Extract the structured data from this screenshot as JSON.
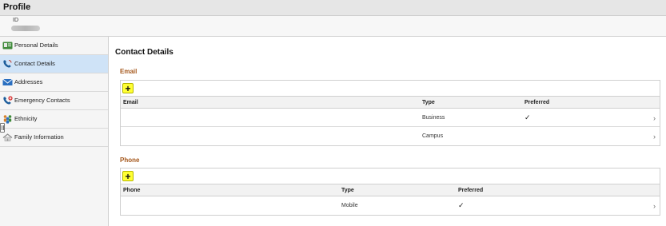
{
  "header": {
    "title": "Profile"
  },
  "id_bar": {
    "label": "ID"
  },
  "sidebar": {
    "items": [
      {
        "label": "Personal Details",
        "icon": "id-card-icon",
        "active": false
      },
      {
        "label": "Contact Details",
        "icon": "phone-icon",
        "active": true
      },
      {
        "label": "Addresses",
        "icon": "envelope-icon",
        "active": false
      },
      {
        "label": "Emergency Contacts",
        "icon": "emergency-phone-icon",
        "active": false
      },
      {
        "label": "Ethnicity",
        "icon": "people-icon",
        "active": false
      },
      {
        "label": "Family Information",
        "icon": "house-icon",
        "active": false
      }
    ]
  },
  "main": {
    "title": "Contact Details",
    "email": {
      "section_title": "Email",
      "add_label": "+",
      "columns": [
        "Email",
        "Type",
        "Preferred"
      ],
      "rows": [
        {
          "email": "",
          "type": "Business",
          "preferred": "✓",
          "chevron": "›"
        },
        {
          "email": "",
          "type": "Campus",
          "preferred": "",
          "chevron": "›"
        }
      ]
    },
    "phone": {
      "section_title": "Phone",
      "add_label": "+",
      "columns": [
        "Phone",
        "Type",
        "Preferred"
      ],
      "rows": [
        {
          "phone": "",
          "type": "Mobile",
          "preferred": "✓",
          "chevron": "›"
        }
      ]
    }
  },
  "colors": {
    "accent_section": "#a4561a",
    "active_nav": "#cfe3f7",
    "add_button": "#ffff33"
  }
}
